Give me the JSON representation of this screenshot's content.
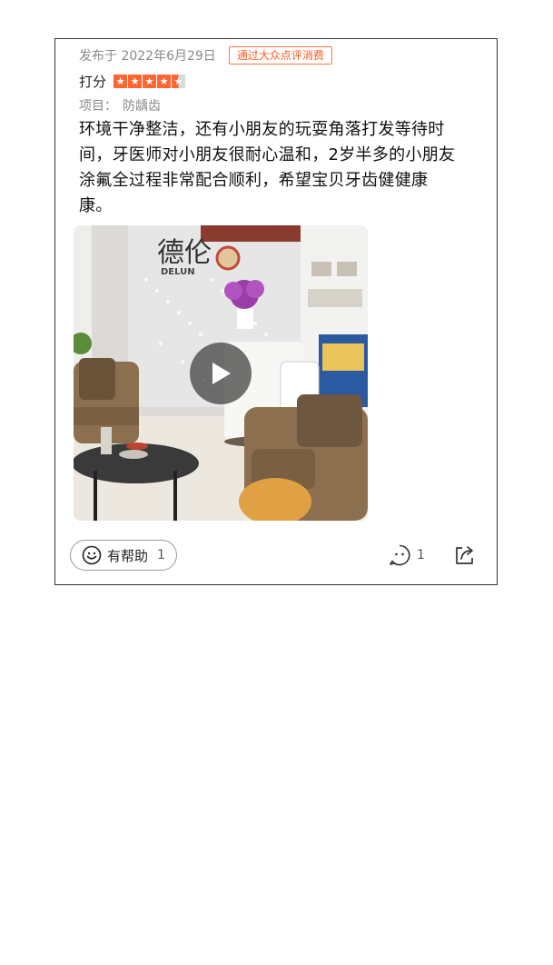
{
  "review": {
    "date": "发布于 2022年6月29日",
    "badge": "通过大众点评消费",
    "rating_label": "打分",
    "rating_value": 4.5,
    "rating_max": 5,
    "project_label": "项目：",
    "project_value": "防龋齿",
    "text": "环境干净整洁，还有小朋友的玩耍角落打发等待时间，牙医师对小朋友很耐心温和，2岁半多的小朋友涂氟全过程非常配合顺利，希望宝贝牙齿健健康康。",
    "sign_text": "德伦",
    "sign_sub": "DELUN"
  },
  "actions": {
    "helpful_label": "有帮助",
    "helpful_count": "1",
    "comment_count": "1"
  },
  "icons": {
    "play": "play-icon",
    "helpful": "smile-icon",
    "comment": "comment-icon",
    "share": "share-icon",
    "star": "star-icon"
  },
  "colors": {
    "accent": "#ff6633",
    "badge": "#ff5a1f",
    "muted": "#8a8a8a"
  }
}
